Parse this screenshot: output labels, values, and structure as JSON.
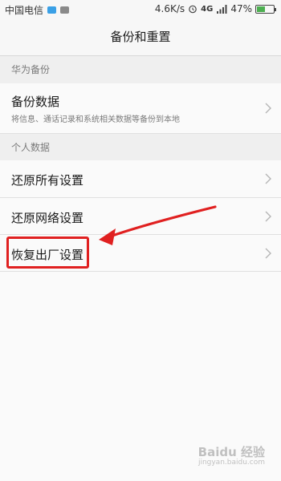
{
  "status_bar": {
    "carrier": "中国电信",
    "speed": "4.6K/s",
    "network": "4G",
    "battery_percent": "47%",
    "battery_level": 0.47,
    "icons": [
      "sim-icon",
      "image-icon",
      "alarm-icon",
      "signal-icon",
      "battery-icon"
    ]
  },
  "header": {
    "title": "备份和重置"
  },
  "sections": {
    "huawei_backup": {
      "title": "华为备份",
      "items": [
        {
          "label": "备份数据",
          "subtitle": "将信息、通话记录和系统相关数据等备份到本地"
        }
      ]
    },
    "personal_data": {
      "title": "个人数据",
      "items": [
        {
          "label": "还原所有设置"
        },
        {
          "label": "还原网络设置"
        },
        {
          "label": "恢复出厂设置"
        }
      ]
    }
  },
  "annotation": {
    "color": "#e02020"
  },
  "watermark": {
    "text": "Baidu 经验",
    "subtext": "jingyan.baidu.com"
  }
}
